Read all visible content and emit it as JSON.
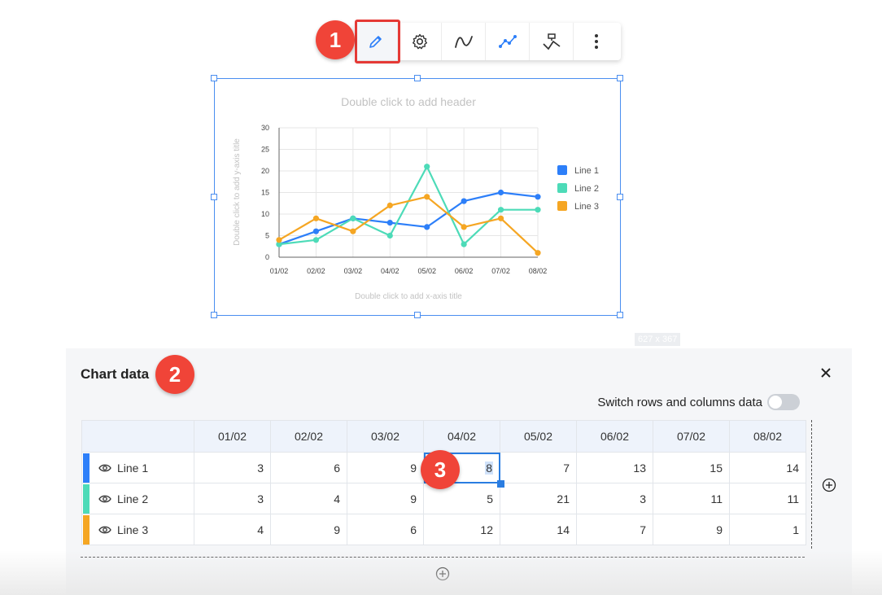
{
  "toolbar": {
    "buttons": [
      "edit-data",
      "settings",
      "curve",
      "line-markers",
      "line-style",
      "more"
    ]
  },
  "markers": [
    "1",
    "2",
    "3"
  ],
  "chart": {
    "size_badge": "627 x 367"
  },
  "chart_data": {
    "type": "line",
    "title": "Double click to add header",
    "xlabel": "Double click to add x-axis title",
    "ylabel": "Double click to add y-axis title",
    "categories": [
      "01/02",
      "02/02",
      "03/02",
      "04/02",
      "05/02",
      "06/02",
      "07/02",
      "08/02"
    ],
    "ylim": [
      0,
      30
    ],
    "yticks": [
      "0",
      "5",
      "10",
      "15",
      "20",
      "25",
      "30"
    ],
    "grid": true,
    "legend": "right",
    "series": [
      {
        "name": "Line 1",
        "color": "#2d7ff9",
        "values": [
          3,
          6,
          9,
          8,
          7,
          13,
          15,
          14
        ]
      },
      {
        "name": "Line 2",
        "color": "#4ddbb8",
        "values": [
          3,
          4,
          9,
          5,
          21,
          3,
          11,
          11
        ]
      },
      {
        "name": "Line 3",
        "color": "#f5a623",
        "values": [
          4,
          9,
          6,
          12,
          14,
          7,
          9,
          1
        ]
      }
    ]
  },
  "panel": {
    "title": "Chart data",
    "switch_label": "Switch rows and columns data",
    "switch_on": false,
    "headers": [
      "01/02",
      "02/02",
      "03/02",
      "04/02",
      "05/02",
      "06/02",
      "07/02",
      "08/02"
    ],
    "rows": [
      {
        "label": "Line 1",
        "color": "#2d7ff9",
        "values": [
          "3",
          "6",
          "9",
          "8",
          "7",
          "13",
          "15",
          "14"
        ]
      },
      {
        "label": "Line 2",
        "color": "#4ddbb8",
        "values": [
          "3",
          "4",
          "9",
          "5",
          "21",
          "3",
          "11",
          "11"
        ]
      },
      {
        "label": "Line 3",
        "color": "#f5a623",
        "values": [
          "4",
          "9",
          "6",
          "12",
          "14",
          "7",
          "9",
          "1"
        ]
      }
    ],
    "selected_cell": {
      "row": 0,
      "col": 3
    }
  },
  "colors": {
    "accent": "#2a7de1",
    "marker": "#f04438"
  }
}
